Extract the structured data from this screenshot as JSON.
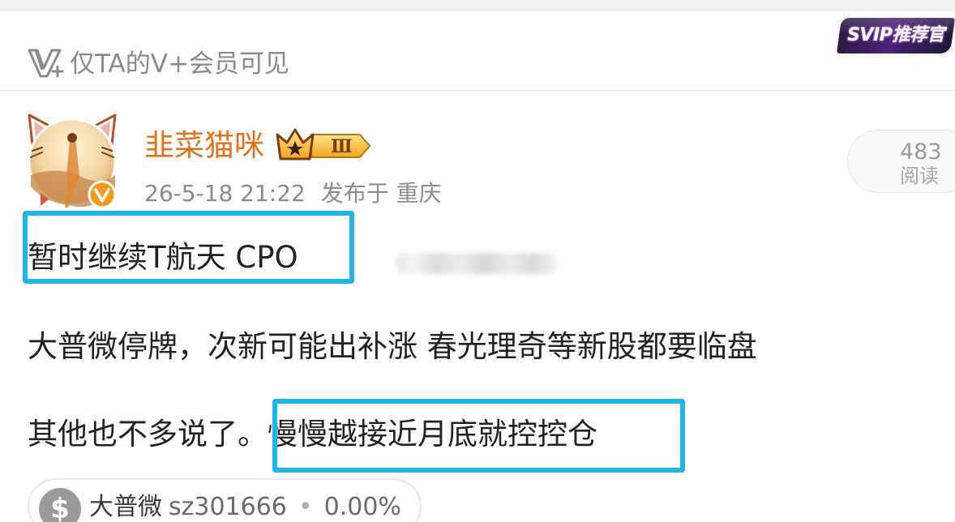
{
  "visibility": {
    "text": "仅TA的V+会员可见",
    "icon": "v-plus-icon"
  },
  "svip_badge": {
    "label": "SVIP推荐官"
  },
  "author": {
    "name": "韭菜猫咪",
    "level_badge": "Ⅲ",
    "verified_icon": "verified-v-icon",
    "avatar": "cat-ear-avatar"
  },
  "post": {
    "date": "26-5-18 21:22",
    "location": "发布于 重庆",
    "read_count": "483",
    "read_label": "阅读",
    "lines": [
      "暂时继续T航天 CPO",
      "大普微停牌，次新可能出补涨 春光理奇等新股都要临盘",
      "其他也不多说了。",
      "慢慢越接近月底就控控仓"
    ]
  },
  "highlight_color": "#1fb5e6",
  "name_color": "#e3731b",
  "stock": {
    "icon": "dollar-icon",
    "name": "大普微",
    "code": "sz301666",
    "separator": "•",
    "change": "0.00%"
  }
}
